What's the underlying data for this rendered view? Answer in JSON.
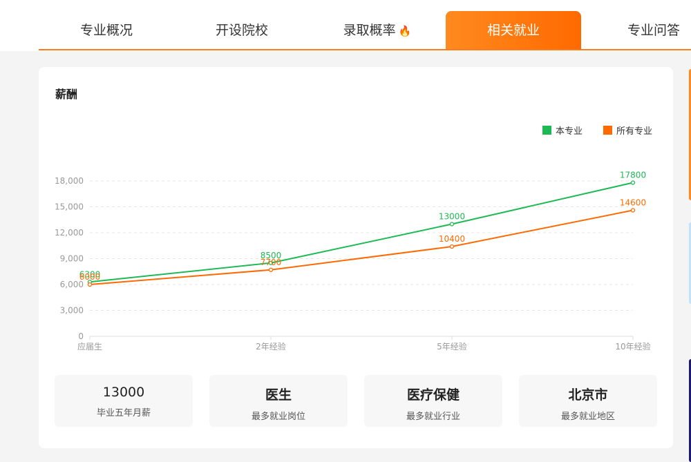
{
  "tabs": [
    {
      "label": "专业概况"
    },
    {
      "label": "开设院校"
    },
    {
      "label": "录取概率",
      "icon": "fire-icon"
    },
    {
      "label": "相关就业",
      "active": true
    },
    {
      "label": "专业问答"
    }
  ],
  "card": {
    "title": "薪酬",
    "legend": [
      {
        "label": "本专业",
        "color": "#1db954"
      },
      {
        "label": "所有专业",
        "color": "#ff6a00"
      }
    ]
  },
  "chart_data": {
    "type": "line",
    "categories": [
      "应届生",
      "2年经验",
      "5年经验",
      "10年经验"
    ],
    "series": [
      {
        "name": "本专业",
        "color": "#1db954",
        "values": [
          6300,
          8500,
          13000,
          17800
        ]
      },
      {
        "name": "所有专业",
        "color": "#ff6a00",
        "values": [
          6000,
          7700,
          10400,
          14600
        ]
      }
    ],
    "yticks": [
      "0",
      "3,000",
      "6,000",
      "9,000",
      "12,000",
      "15,000",
      "18,000"
    ],
    "ylim": [
      0,
      18000
    ],
    "grid": true,
    "legend_position": "top-right"
  },
  "stats": [
    {
      "value": "13000",
      "label": "毕业五年月薪"
    },
    {
      "value": "医生",
      "label": "最多就业岗位"
    },
    {
      "value": "医疗保健",
      "label": "最多就业行业"
    },
    {
      "value": "北京市",
      "label": "最多就业地区"
    }
  ]
}
